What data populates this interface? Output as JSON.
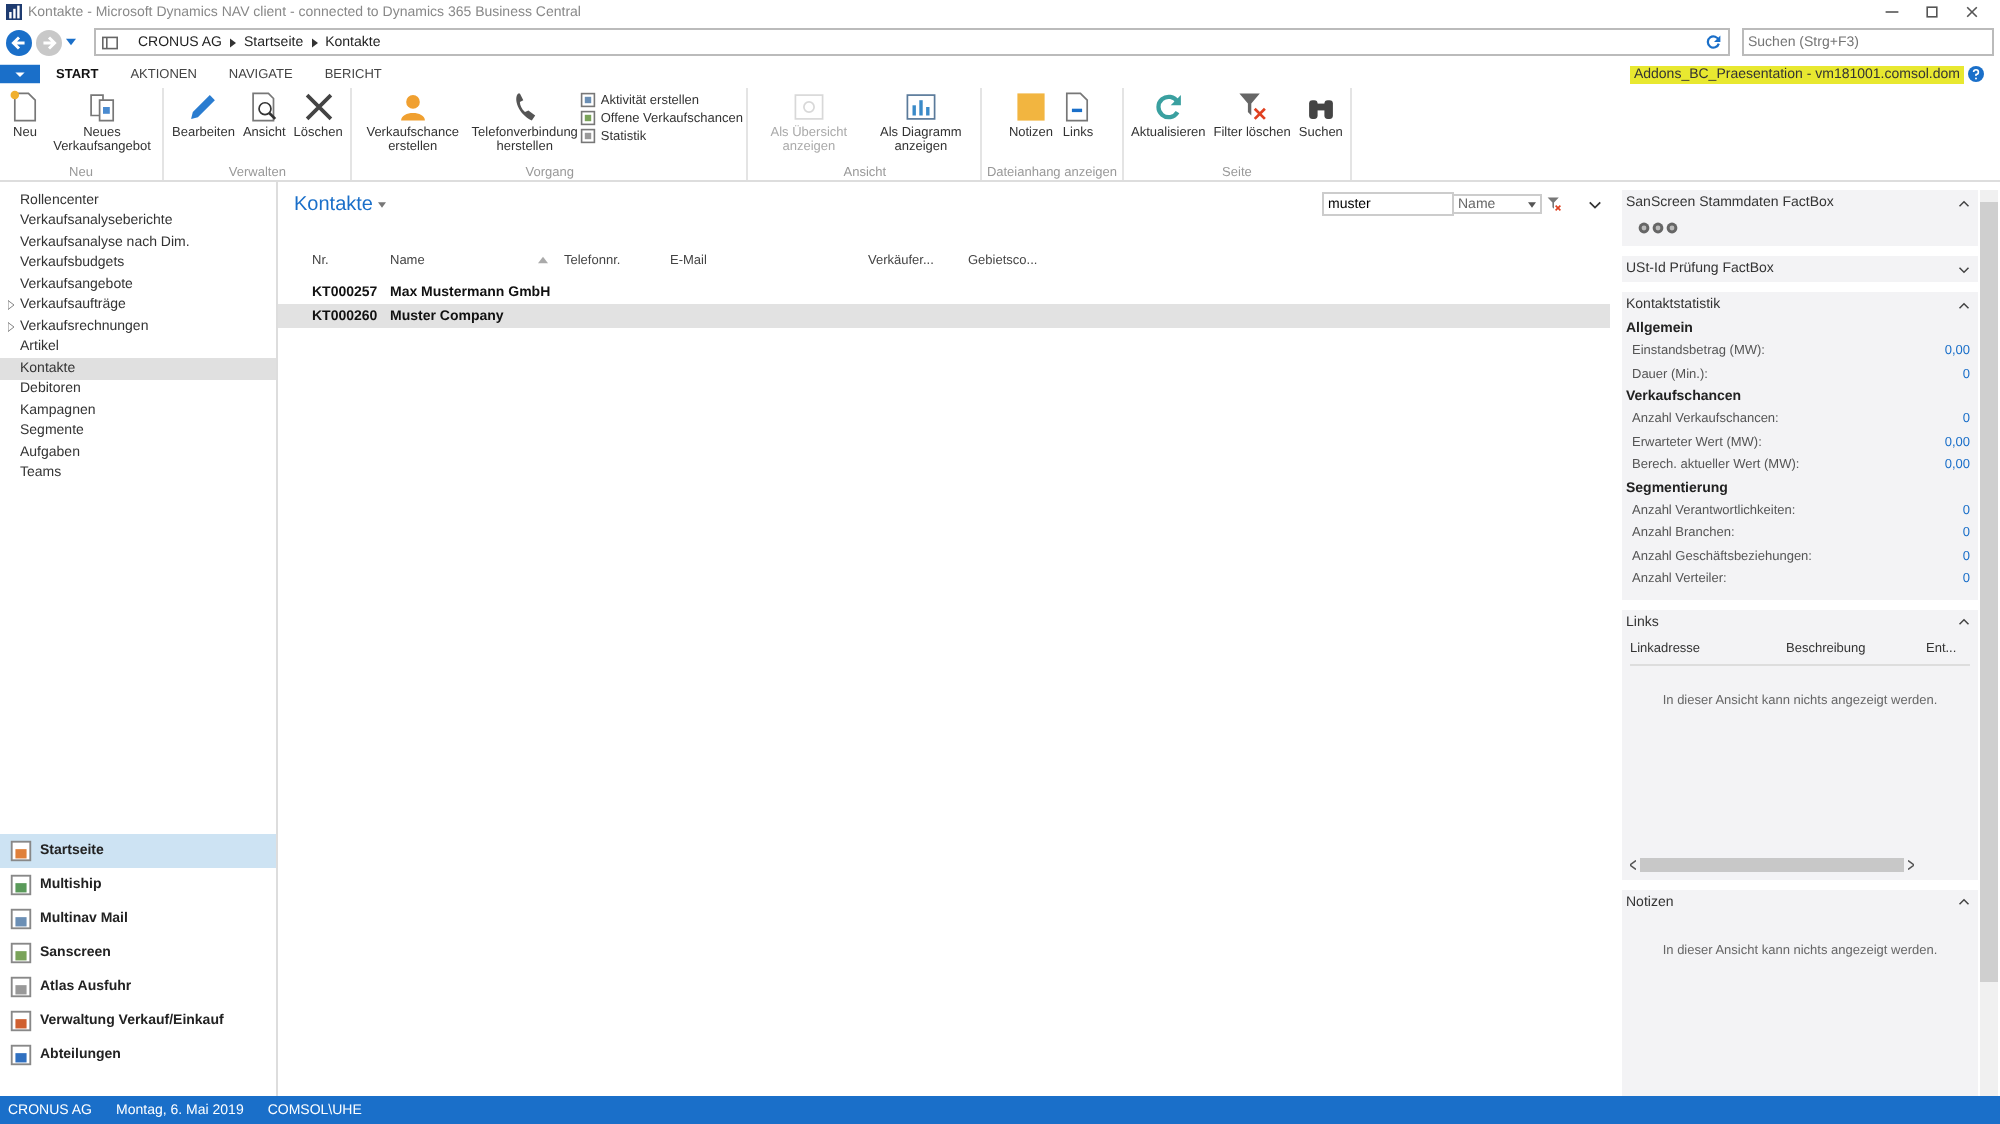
{
  "window": {
    "title": "Kontakte - Microsoft Dynamics NAV client - connected to Dynamics 365 Business Central"
  },
  "address": {
    "breadcrumb": [
      "CRONUS AG",
      "Startseite",
      "Kontakte"
    ],
    "search_placeholder": "Suchen (Strg+F3)"
  },
  "ribbon": {
    "tabs": [
      {
        "label": "START",
        "selected": true
      },
      {
        "label": "AKTIONEN",
        "selected": false
      },
      {
        "label": "NAVIGATE",
        "selected": false
      },
      {
        "label": "BERICHT",
        "selected": false
      }
    ],
    "server": "Addons_BC_Praesentation - vm181001.comsol.dom",
    "groups": [
      {
        "label": "Neu",
        "items": [
          {
            "kind": "large",
            "label": "Neu",
            "disabled": false
          },
          {
            "kind": "large",
            "label": "Neues Verkaufsangebot",
            "disabled": false
          }
        ]
      },
      {
        "label": "Verwalten",
        "items": [
          {
            "kind": "large",
            "label": "Bearbeiten",
            "disabled": false
          },
          {
            "kind": "large",
            "label": "Ansicht",
            "disabled": false
          },
          {
            "kind": "large",
            "label": "Löschen",
            "disabled": false
          }
        ]
      },
      {
        "label": "Vorgang",
        "items": [
          {
            "kind": "large",
            "label": "Verkaufschance erstellen",
            "disabled": false
          },
          {
            "kind": "large",
            "label": "Telefonverbindung herstellen",
            "disabled": false
          },
          {
            "kind": "small",
            "label": "Aktivität erstellen",
            "disabled": false
          },
          {
            "kind": "small",
            "label": "Offene Verkaufschancen",
            "disabled": false
          },
          {
            "kind": "small",
            "label": "Statistik",
            "disabled": false
          }
        ]
      },
      {
        "label": "Ansicht",
        "items": [
          {
            "kind": "large",
            "label": "Als Übersicht anzeigen",
            "disabled": true
          },
          {
            "kind": "large",
            "label": "Als Diagramm anzeigen",
            "disabled": false
          }
        ]
      },
      {
        "label": "Dateianhang anzeigen",
        "items": [
          {
            "kind": "large",
            "label": "Notizen",
            "disabled": false
          },
          {
            "kind": "large",
            "label": "Links",
            "disabled": false
          }
        ]
      },
      {
        "label": "Seite",
        "items": [
          {
            "kind": "large",
            "label": "Aktualisieren",
            "disabled": false
          },
          {
            "kind": "large",
            "label": "Filter löschen",
            "disabled": false
          },
          {
            "kind": "large",
            "label": "Suchen",
            "disabled": false
          }
        ]
      }
    ]
  },
  "navigation": {
    "items": [
      {
        "kind": "link",
        "label": "Rollencenter",
        "selected": false
      },
      {
        "kind": "link",
        "label": "Verkaufsanalyseberichte",
        "selected": false
      },
      {
        "kind": "link",
        "label": "Verkaufsanalyse nach Dim.",
        "selected": false
      },
      {
        "kind": "link",
        "label": "Verkaufsbudgets",
        "selected": false
      },
      {
        "kind": "link",
        "label": "Verkaufsangebote",
        "selected": false
      },
      {
        "kind": "group",
        "label": "Verkaufsaufträge",
        "selected": false
      },
      {
        "kind": "group",
        "label": "Verkaufsrechnungen",
        "selected": false
      },
      {
        "kind": "link",
        "label": "Artikel",
        "selected": false
      },
      {
        "kind": "link",
        "label": "Kontakte",
        "selected": true
      },
      {
        "kind": "link",
        "label": "Debitoren",
        "selected": false
      },
      {
        "kind": "link",
        "label": "Kampagnen",
        "selected": false
      },
      {
        "kind": "link",
        "label": "Segmente",
        "selected": false
      },
      {
        "kind": "link",
        "label": "Aufgaben",
        "selected": false
      },
      {
        "kind": "link",
        "label": "Teams",
        "selected": false
      }
    ],
    "departments": [
      {
        "label": "Startseite",
        "selected": true
      },
      {
        "label": "Multiship",
        "selected": false
      },
      {
        "label": "Multinav Mail",
        "selected": false
      },
      {
        "label": "Sanscreen",
        "selected": false
      },
      {
        "label": "Atlas Ausfuhr",
        "selected": false
      },
      {
        "label": "Verwaltung Verkauf/Einkauf",
        "selected": false
      },
      {
        "label": "Abteilungen",
        "selected": false
      }
    ]
  },
  "list": {
    "title": "Kontakte",
    "filter": {
      "value": "muster",
      "field": "Name"
    },
    "columns": [
      {
        "label": "Nr.",
        "sorted": false
      },
      {
        "label": "Name",
        "sorted": true
      },
      {
        "label": "Telefonnr.",
        "sorted": false
      },
      {
        "label": "E-Mail",
        "sorted": false
      },
      {
        "label": "Verkäufer...",
        "sorted": false
      },
      {
        "label": "Gebietsco...",
        "sorted": false
      }
    ],
    "rows": [
      {
        "no": "KT000257",
        "name": "Max Mustermann GmbH",
        "selected": false
      },
      {
        "no": "KT000260",
        "name": "Muster Company",
        "selected": true
      }
    ]
  },
  "factboxes": [
    {
      "kind": "icons",
      "title": "SanScreen Stammdaten FactBox",
      "expanded": true
    },
    {
      "kind": "icons",
      "title": "USt-Id Prüfung FactBox",
      "expanded": false
    },
    {
      "kind": "stats",
      "title": "Kontaktstatistik",
      "expanded": true,
      "sections": [
        {
          "title": "Allgemein",
          "rows": [
            {
              "label": "Einstandsbetrag (MW):",
              "value": "0,00"
            },
            {
              "label": "Dauer (Min.):",
              "value": "0"
            }
          ]
        },
        {
          "title": "Verkaufschancen",
          "rows": [
            {
              "label": "Anzahl Verkaufschancen:",
              "value": "0"
            },
            {
              "label": "Erwarteter Wert (MW):",
              "value": "0,00"
            },
            {
              "label": "Berech. aktueller Wert (MW):",
              "value": "0,00"
            }
          ]
        },
        {
          "title": "Segmentierung",
          "rows": [
            {
              "label": "Anzahl Verantwortlichkeiten:",
              "value": "0"
            },
            {
              "label": "Anzahl Branchen:",
              "value": "0"
            },
            {
              "label": "Anzahl Geschäftsbeziehungen:",
              "value": "0"
            },
            {
              "label": "Anzahl Verteiler:",
              "value": "0"
            }
          ]
        }
      ]
    },
    {
      "kind": "table",
      "title": "Links",
      "expanded": true,
      "columns": [
        "Linkadresse",
        "Beschreibung",
        "Ent..."
      ],
      "empty": "In dieser Ansicht kann nichts angezeigt werden."
    },
    {
      "kind": "note",
      "title": "Notizen",
      "expanded": true,
      "empty": "In dieser Ansicht kann nichts angezeigt werden."
    }
  ],
  "status_bar": [
    "CRONUS AG",
    "Montag, 6. Mai 2019",
    "COMSOL\\UHE"
  ]
}
